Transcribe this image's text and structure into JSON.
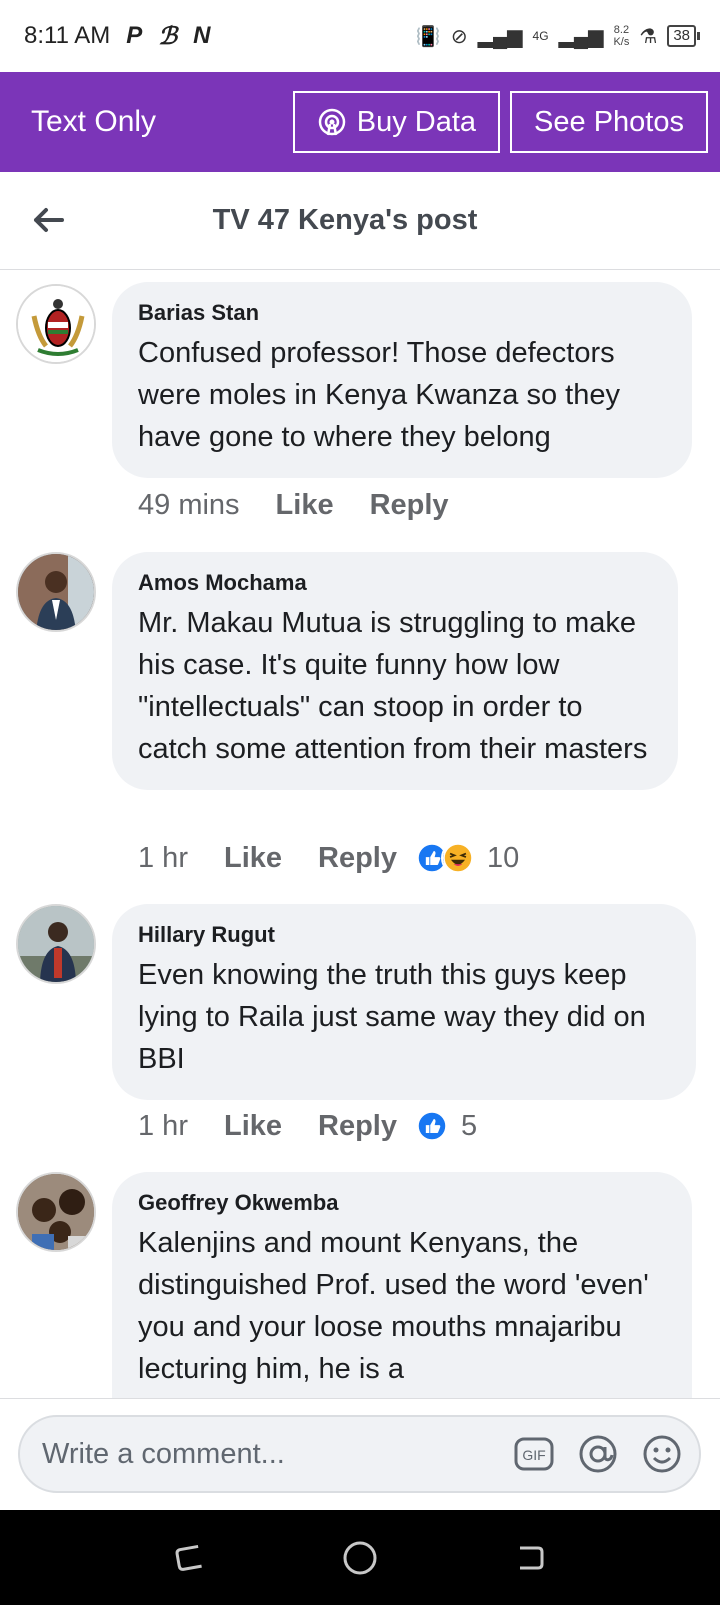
{
  "status": {
    "time": "8:11 AM",
    "notif_icons": [
      "P",
      "ℬ",
      "N"
    ],
    "network": "4G",
    "speed_value": "8.2",
    "speed_unit": "K/s",
    "battery": "38"
  },
  "topbar": {
    "text_only": "Text Only",
    "buy_data": "Buy Data",
    "see_photos": "See Photos",
    "bg_color": "#7b35b8"
  },
  "post": {
    "title": "TV 47 Kenya's post"
  },
  "comments": [
    {
      "author": "Barias Stan",
      "text": "Confused professor! Those defectors were moles in Kenya Kwanza so they have gone to where they belong",
      "time": "49 mins",
      "like": "Like",
      "reply": "Reply"
    },
    {
      "author": "Amos Mochama",
      "text": "Mr. Makau Mutua is struggling to make his case. It's quite funny how low \"intellectuals\" can stoop in order to catch some attention from their masters",
      "time": "1 hr",
      "like": "Like",
      "reply": "Reply",
      "reactions": [
        "like",
        "haha"
      ],
      "reaction_count": "10"
    },
    {
      "author": "Hillary Rugut",
      "text": "Even knowing the truth this guys keep lying to Raila just same way they did on BBI",
      "time": "1 hr",
      "like": "Like",
      "reply": "Reply",
      "reactions": [
        "like"
      ],
      "reaction_count": "5"
    },
    {
      "author": "Geoffrey Okwemba",
      "text": "Kalenjins and mount Kenyans, the distinguished Prof. used the word 'even' you and your loose mouths mnajaribu lecturing him, he is a"
    }
  ],
  "composer": {
    "placeholder": "Write a comment...",
    "gif_label": "GIF"
  }
}
